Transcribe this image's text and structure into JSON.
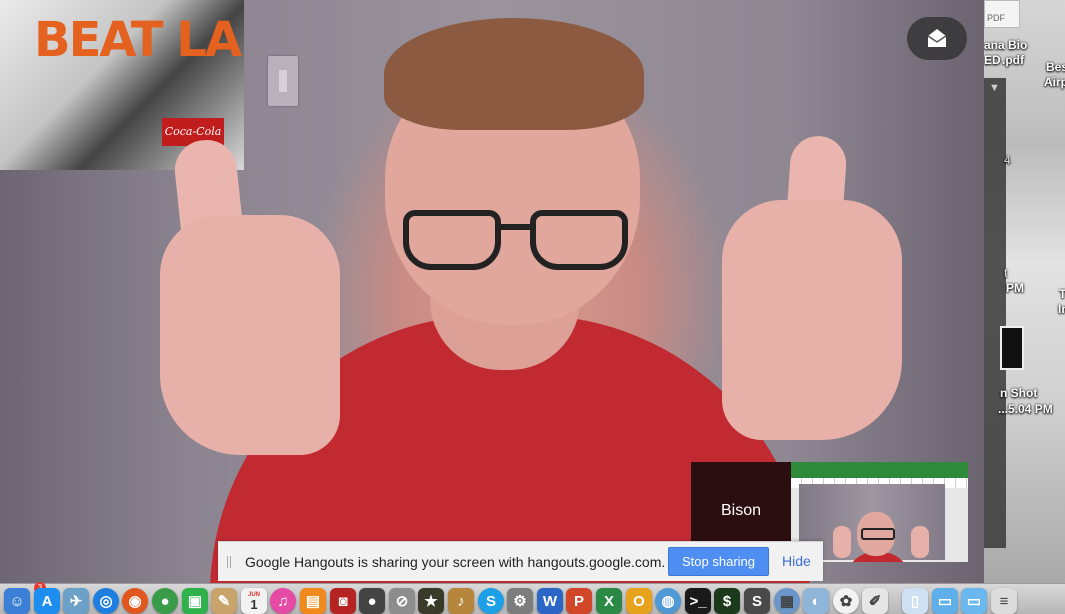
{
  "desktop": {
    "pdf_tag": "PDF",
    "file1_line1": "ana Bio",
    "file1_line2": "ED",
    "file1_line2b": ".pdf",
    "file2_line1": "Bes",
    "file2_line2": "Airp",
    "panel_arrow": "▼",
    "side_num": "4",
    "time1": "PM",
    "time1_prefix": "t",
    "file3_t": "T",
    "file3_i": "In",
    "screenshot_line1": "n Shot",
    "screenshot_line2": "...5.04 PM"
  },
  "hangout": {
    "poster_text": "BEAT LA",
    "poster_logo": "Coca-Cola",
    "participants": [
      {
        "name": "Bison"
      }
    ],
    "share_bar": {
      "message": "Google Hangouts is sharing your screen with hangouts.google.com.",
      "stop_label": "Stop sharing",
      "hide_label": "Hide"
    }
  },
  "dock": {
    "badge_count": "3",
    "calendar_month": "JUN",
    "calendar_day": "1",
    "items": [
      {
        "name": "finder-icon",
        "glyph": "☺",
        "color": "#3b7fd6"
      },
      {
        "name": "app-store-icon",
        "glyph": "A",
        "color": "#1d8df0"
      },
      {
        "name": "preview-icon",
        "glyph": "✈",
        "color": "#6ba0c8"
      },
      {
        "name": "safari-icon",
        "glyph": "◎",
        "color": "#1f7fe0"
      },
      {
        "name": "firefox-icon",
        "glyph": "◉",
        "color": "#e2571e"
      },
      {
        "name": "chrome-icon",
        "glyph": "●",
        "color": "#3a9b48"
      },
      {
        "name": "facetime-icon",
        "glyph": "▣",
        "color": "#2fb24c"
      },
      {
        "name": "notes-icon",
        "glyph": "✎",
        "color": "#c8a46a"
      },
      {
        "name": "calendar-icon",
        "glyph": "1",
        "color": "#f2f2f2"
      },
      {
        "name": "itunes-icon",
        "glyph": "♫",
        "color": "#e54aa4"
      },
      {
        "name": "ibooks-icon",
        "glyph": "▤",
        "color": "#f08a1c"
      },
      {
        "name": "photo-booth-icon",
        "glyph": "◙",
        "color": "#b62323"
      },
      {
        "name": "bomb-icon",
        "glyph": "●",
        "color": "#444"
      },
      {
        "name": "no-entry-icon",
        "glyph": "⊘",
        "color": "#8d8d8d"
      },
      {
        "name": "star-icon",
        "glyph": "★",
        "color": "#3a3a2a"
      },
      {
        "name": "guitar-icon",
        "glyph": "♪",
        "color": "#b6863c"
      },
      {
        "name": "skype-icon",
        "glyph": "S",
        "color": "#1da0e8"
      },
      {
        "name": "system-preferences-icon",
        "glyph": "⚙",
        "color": "#7d7d7d"
      },
      {
        "name": "word-icon",
        "glyph": "W",
        "color": "#2b66c6"
      },
      {
        "name": "powerpoint-icon",
        "glyph": "P",
        "color": "#d2472a"
      },
      {
        "name": "excel-icon",
        "glyph": "X",
        "color": "#2a8a45"
      },
      {
        "name": "outlook-icon",
        "glyph": "O",
        "color": "#e7a21e"
      },
      {
        "name": "globe-icon",
        "glyph": "◍",
        "color": "#4f9ad6"
      },
      {
        "name": "terminal-icon",
        "glyph": ">_",
        "color": "#1a1a1a"
      },
      {
        "name": "terminal-green-icon",
        "glyph": "$",
        "color": "#1b3a1b"
      },
      {
        "name": "sublime-icon",
        "glyph": "S",
        "color": "#4a4a4a"
      },
      {
        "name": "preview-photos-icon",
        "glyph": "▦",
        "color": "#6a96c9"
      },
      {
        "name": "image-capture-icon",
        "glyph": "◐",
        "color": "#8fb6d8"
      },
      {
        "name": "photos-icon",
        "glyph": "✿",
        "color": "#f2f2f2"
      },
      {
        "name": "textedit-icon",
        "glyph": "✐",
        "color": "#e6e6e6"
      },
      {
        "name": "document-icon",
        "glyph": "▯",
        "color": "#cfe0f2"
      },
      {
        "name": "folder-icon",
        "glyph": "▭",
        "color": "#5fb0ea"
      },
      {
        "name": "downloads-folder-icon",
        "glyph": "▭",
        "color": "#6bb8ee"
      },
      {
        "name": "stack-icon",
        "glyph": "≡",
        "color": "#dcdcdc"
      }
    ]
  }
}
